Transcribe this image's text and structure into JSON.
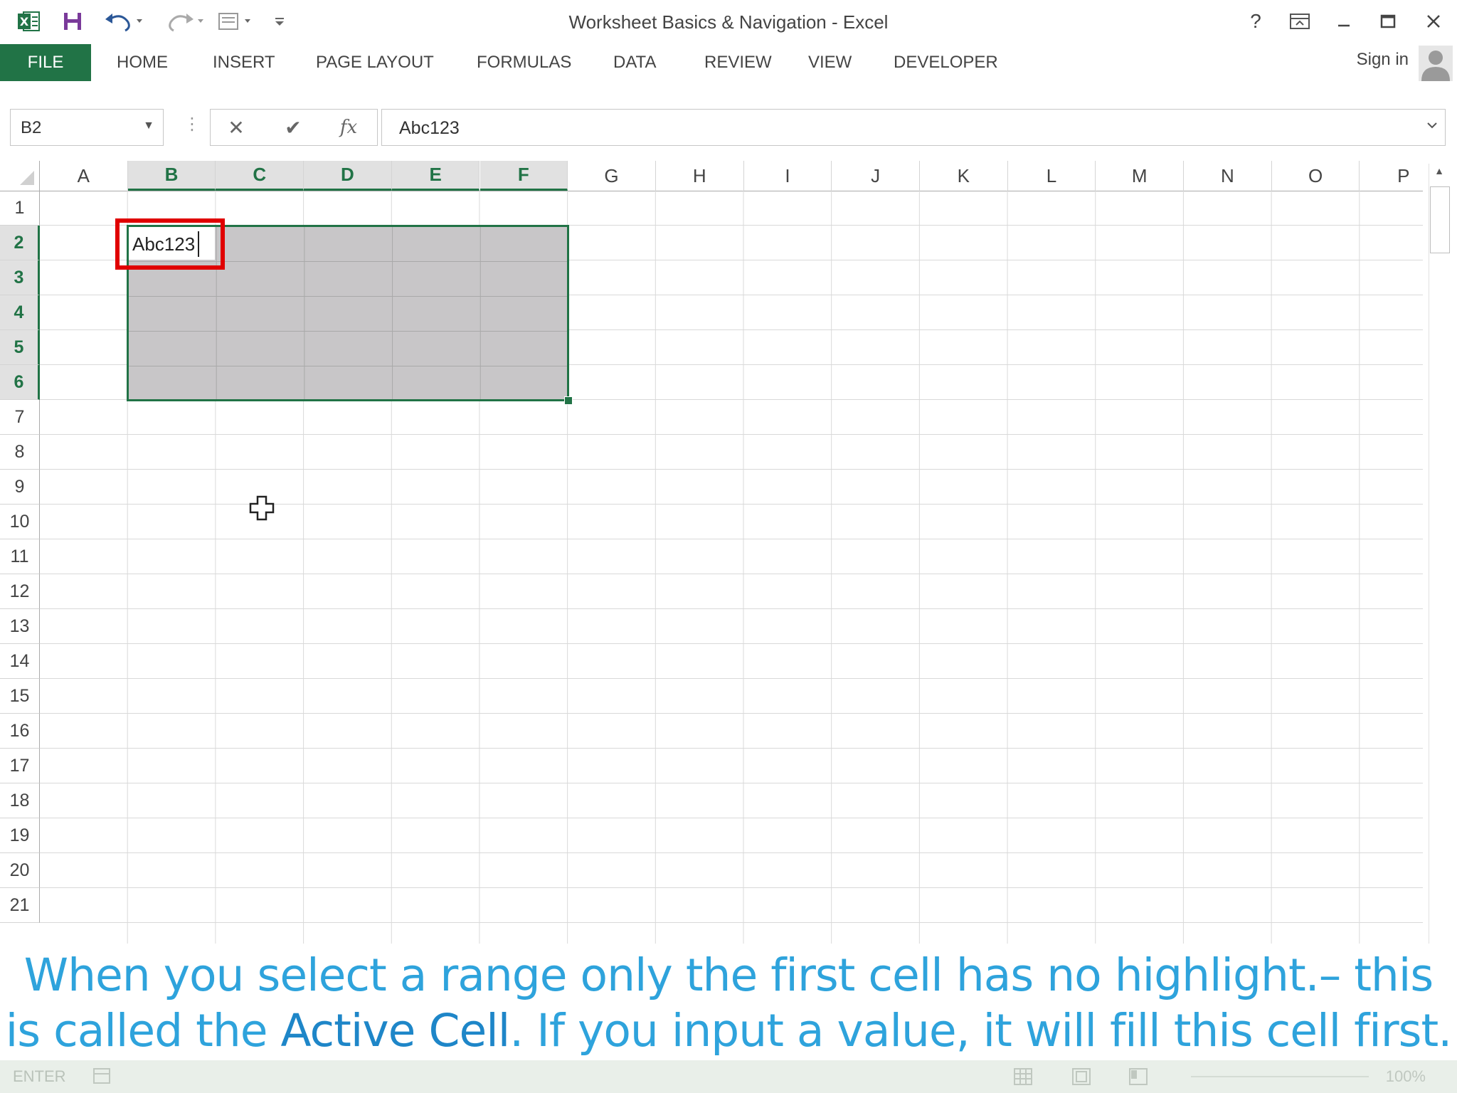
{
  "window": {
    "title": "Worksheet Basics & Navigation - Excel",
    "help": "?",
    "controls": [
      "ribbon-options",
      "minimize",
      "maximize",
      "close"
    ]
  },
  "ribbon": {
    "file_tab": "FILE",
    "tabs": [
      "HOME",
      "INSERT",
      "PAGE LAYOUT",
      "FORMULAS",
      "DATA",
      "REVIEW",
      "VIEW",
      "DEVELOPER"
    ],
    "sign_in": "Sign in"
  },
  "formula_bar": {
    "name_box": "B2",
    "formula": "Abc123",
    "fx": "fx"
  },
  "grid": {
    "columns": [
      "A",
      "B",
      "C",
      "D",
      "E",
      "F",
      "G",
      "H",
      "I",
      "J",
      "K",
      "L",
      "M",
      "N",
      "O",
      "P"
    ],
    "rows": [
      "1",
      "2",
      "3",
      "4",
      "5",
      "6",
      "7",
      "8",
      "9",
      "10",
      "11",
      "12",
      "13",
      "14",
      "15",
      "16",
      "17",
      "18",
      "19",
      "20",
      "21"
    ],
    "selected_columns": [
      "B",
      "C",
      "D",
      "E",
      "F"
    ],
    "selected_rows": [
      "2",
      "3",
      "4",
      "5",
      "6"
    ],
    "active_cell_value": "Abc123"
  },
  "caption": {
    "line1": "When you select a range only the first cell has no highlight.– this",
    "line2_prefix": "is called the ",
    "line2_bold": "Active Cell",
    "line2_suffix": ". If you input a value, it will fill this cell first."
  },
  "status_bar": {
    "mode": "ENTER",
    "zoom": "100%"
  },
  "colors": {
    "excel_green": "#217346",
    "selection_fill": "#c8c6c8",
    "highlight_red": "#e00000",
    "caption_blue": "#2ea3dc"
  }
}
